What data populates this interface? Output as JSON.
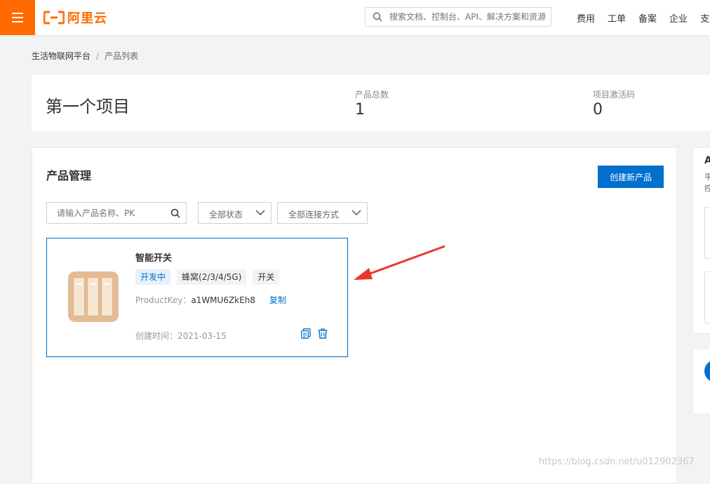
{
  "header": {
    "logo_text": "阿里云",
    "search_placeholder": "搜索文档、控制台、API、解决方案和资源",
    "nav": [
      "费用",
      "工单",
      "备案",
      "企业",
      "支持"
    ]
  },
  "breadcrumb": {
    "items": [
      "生活物联网平台",
      "产品列表"
    ],
    "separator": "/"
  },
  "project": {
    "title": "第一个项目",
    "stats": [
      {
        "label": "产品总数",
        "value": "1"
      },
      {
        "label": "项目激活码",
        "value": "0"
      }
    ]
  },
  "product_panel": {
    "title": "产品管理",
    "create_button": "创建新产品",
    "search_placeholder": "请输入产品名称、PK",
    "status_filter": "全部状态",
    "connection_filter": "全部连接方式"
  },
  "products": [
    {
      "name": "智能开关",
      "tags": [
        "开发中",
        "蜂窝(2/3/4/5G)",
        "开关"
      ],
      "product_key_label": "ProductKey：",
      "product_key": "a1WMU6ZkEh8",
      "copy_label": "复制",
      "created_label": "创建时间：",
      "created_date": "2021-03-15"
    }
  ],
  "right_panel": {
    "title_fragment": "A",
    "text_line1": "平",
    "text_line2": "控"
  },
  "watermark": "https://blog.csdn.net/u012902367",
  "colors": {
    "brand_orange": "#ff6a00",
    "primary_blue": "#0070cc",
    "annotation_red": "#e8382b"
  }
}
